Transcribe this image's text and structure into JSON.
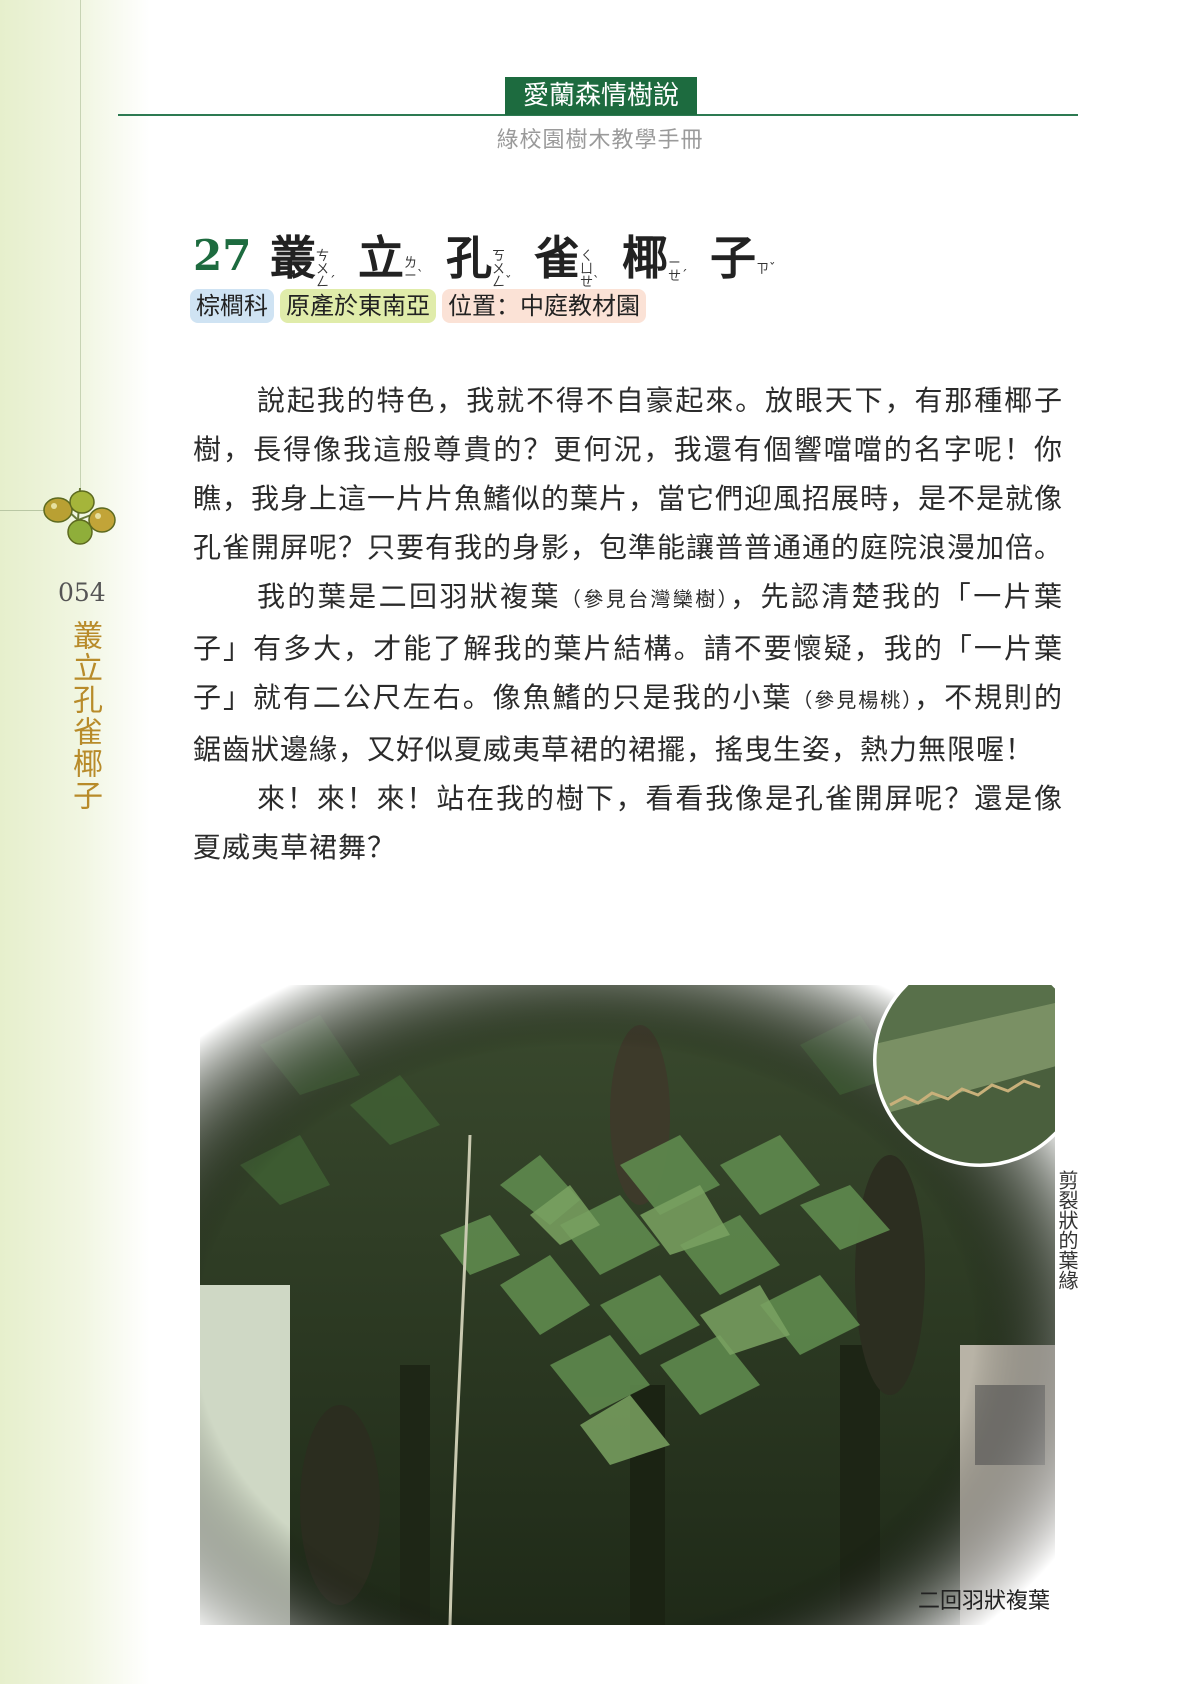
{
  "header": {
    "series_title": "愛蘭森情樹說",
    "subtitle": "綠校園樹木教學手冊"
  },
  "side": {
    "page_number": "054",
    "vertical_title": "叢立孔雀椰子"
  },
  "entry": {
    "number": "27",
    "title_chars": [
      {
        "char": "叢",
        "zhuyin": "ㄘㄨㄥˊ"
      },
      {
        "char": "立",
        "zhuyin": "ㄌㄧˋ"
      },
      {
        "char": "孔",
        "zhuyin": "ㄎㄨㄥˇ"
      },
      {
        "char": "雀",
        "zhuyin": "ㄑㄩㄝˋ"
      },
      {
        "char": "椰",
        "zhuyin": "ㄧㄝˊ"
      },
      {
        "char": "子",
        "zhuyin": "ㄗˇ"
      }
    ],
    "tags": {
      "family": "棕櫚科",
      "origin": "原產於東南亞",
      "location": "位置：中庭教材園"
    }
  },
  "body": {
    "p1": "說起我的特色，我就不得不自豪起來。放眼天下，有那種椰子樹，長得像我這般尊貴的？更何況，我還有個響噹噹的名字呢！你瞧，我身上這一片片魚鰭似的葉片，當它們迎風招展時，是不是就像孔雀開屏呢？只要有我的身影，包準能讓普普通通的庭院浪漫加倍。",
    "p2_a": "我的葉是二回羽狀複葉",
    "p2_ref1": "（參見台灣欒樹）",
    "p2_b": "，先認清楚我的「一片葉子」有多大，才能了解我的葉片結構。請不要懷疑，我的「一片葉子」就有二公尺左右。像魚鰭的只是我的小葉",
    "p2_ref2": "（參見楊桃）",
    "p2_c": "，不規則的鋸齒狀邊緣，又好似夏威夷草裙的裙擺，搖曳生姿，熱力無限喔！",
    "p3": "來！來！來！站在我的樹下，看看我像是孔雀開屏呢？還是像夏威夷草裙舞？"
  },
  "photo": {
    "caption_inset": "剪裂狀的葉緣",
    "caption_main": "二回羽狀複葉"
  },
  "colors": {
    "accent_green": "#1d6b3f",
    "side_title_gold": "#b88b2a"
  }
}
